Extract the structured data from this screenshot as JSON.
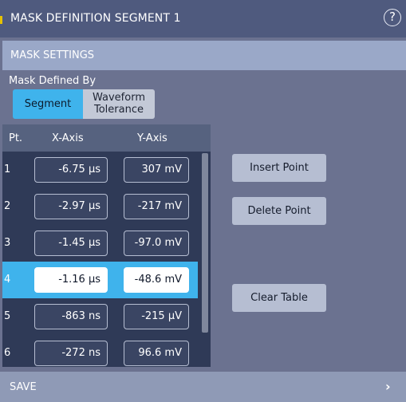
{
  "title": "MASK DEFINITION SEGMENT  1",
  "help_glyph": "?",
  "settings_header": "MASK SETTINGS",
  "mask_defined_by": {
    "label": "Mask Defined By",
    "options": [
      "Segment",
      "Waveform Tolerance"
    ],
    "option_lines": {
      "waveform_1": "Waveform",
      "waveform_2": "Tolerance"
    },
    "selected": "Segment"
  },
  "table": {
    "headers": [
      "Pt.",
      "X-Axis",
      "Y-Axis"
    ],
    "rows": [
      {
        "pt": "1",
        "x": "-6.75 µs",
        "y": "307 mV"
      },
      {
        "pt": "2",
        "x": "-2.97 µs",
        "y": "-217 mV"
      },
      {
        "pt": "3",
        "x": "-1.45 µs",
        "y": "-97.0 mV"
      },
      {
        "pt": "4",
        "x": "-1.16 µs",
        "y": "-48.6 mV"
      },
      {
        "pt": "5",
        "x": "-863 ns",
        "y": "-215 µV"
      },
      {
        "pt": "6",
        "x": "-272 ns",
        "y": "96.6 mV"
      }
    ],
    "selected_row": "4"
  },
  "actions": {
    "insert_point": "Insert Point",
    "delete_point": "Delete Point",
    "clear_table": "Clear Table"
  },
  "save": {
    "label": "SAVE",
    "chevron": "›"
  },
  "colors": {
    "accent_selected": "#3fb3ec",
    "title_bar": "#4f5a7e",
    "panel_bg": "#6b7290",
    "section_header": "#9aa8c8"
  }
}
